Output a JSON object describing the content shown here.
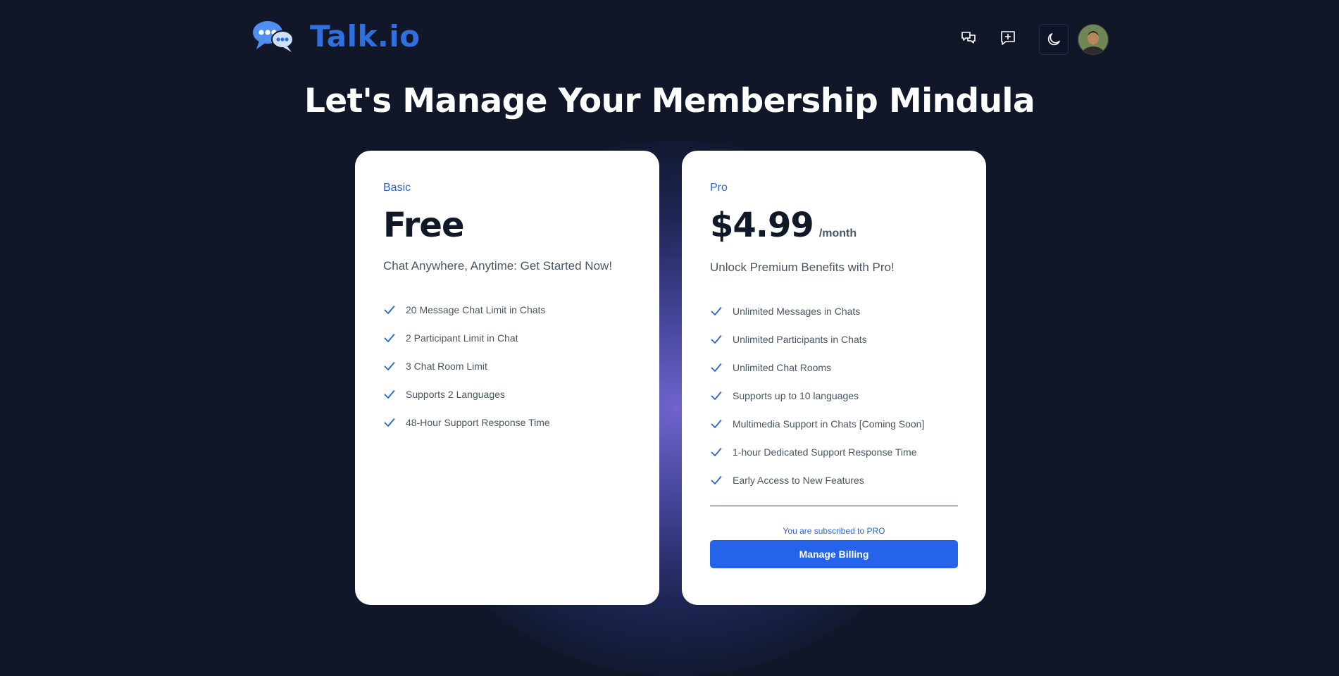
{
  "app": {
    "logo_text": "Talk.io"
  },
  "header": {
    "icons": [
      "chats-icon",
      "new-chat-icon",
      "moon-icon",
      "user-avatar"
    ]
  },
  "page": {
    "title": "Let's Manage Your Membership Mindula"
  },
  "plans": [
    {
      "name": "Basic",
      "price": "Free",
      "period": "",
      "tagline": "Chat Anywhere, Anytime: Get Started Now!",
      "features": [
        "20 Message Chat Limit in Chats",
        "2 Participant Limit in Chat",
        "3 Chat Room Limit",
        "Supports 2 Languages",
        "48-Hour Support Response Time"
      ]
    },
    {
      "name": "Pro",
      "price": "$4.99",
      "period": "/month",
      "tagline": "Unlock Premium Benefits with Pro!",
      "features": [
        "Unlimited Messages in Chats",
        "Unlimited Participants in Chats",
        "Unlimited Chat Rooms",
        "Supports up to 10 languages",
        "Multimedia Support in Chats [Coming Soon]",
        "1-hour Dedicated Support Response Time",
        "Early Access to New Features"
      ],
      "status_text": "You are subscribed to PRO",
      "button_label": "Manage Billing"
    }
  ],
  "colors": {
    "background": "#111729",
    "accent": "#2563eb",
    "logo": "#2f6fe0",
    "card": "#ffffff"
  }
}
